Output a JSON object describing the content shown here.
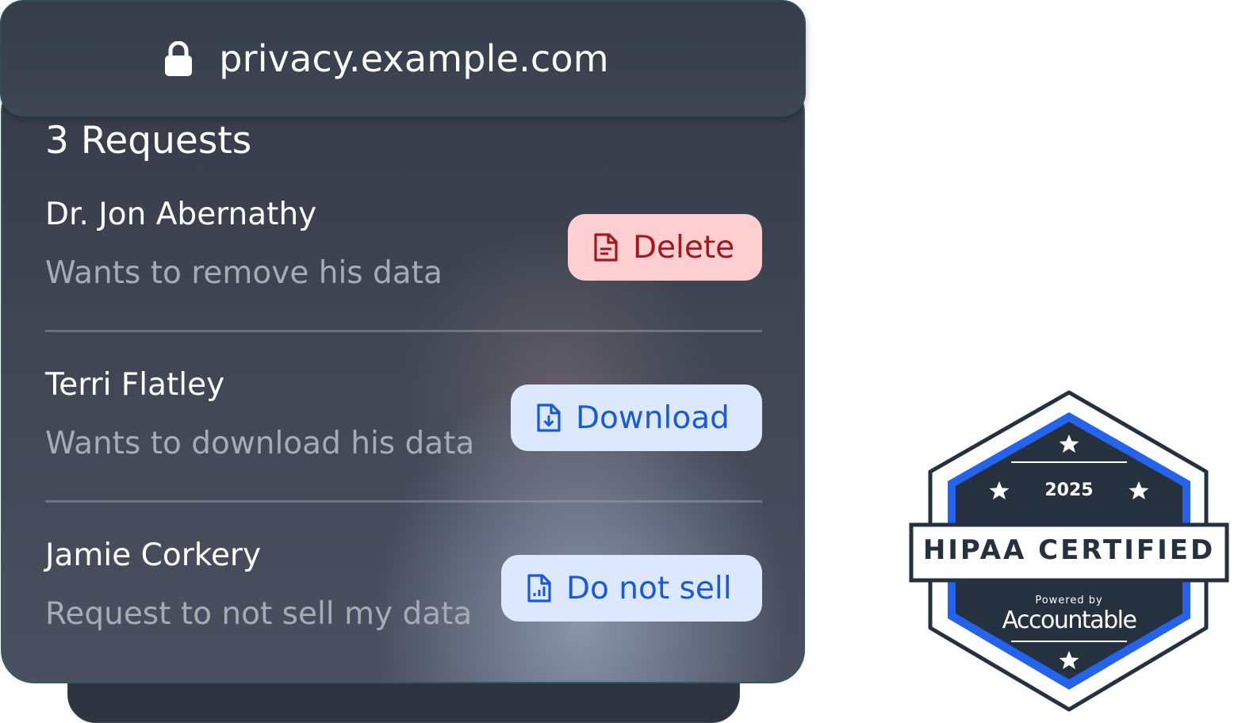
{
  "url_bar": {
    "icon": "lock-icon",
    "url": "privacy.example.com"
  },
  "requests": {
    "title": "3 Requests",
    "items": [
      {
        "name": "Dr. Jon Abernathy",
        "description": "Wants to remove his data",
        "action_label": "Delete",
        "action_icon": "file-text-icon",
        "action_color": "#a3171d"
      },
      {
        "name": "Terri Flatley",
        "description": "Wants to download his data",
        "action_label": "Download",
        "action_icon": "file-download-icon",
        "action_color": "#1a5ad6"
      },
      {
        "name": "Jamie Corkery",
        "description": "Request to not sell my data",
        "action_label": "Do not sell",
        "action_icon": "file-chart-icon",
        "action_color": "#1a5ad6"
      }
    ]
  },
  "badge": {
    "year": "2025",
    "title": "HIPAA CERTIFIED",
    "powered_by": "Powered by",
    "brand": "Accountable",
    "accent_color": "#2563eb"
  }
}
